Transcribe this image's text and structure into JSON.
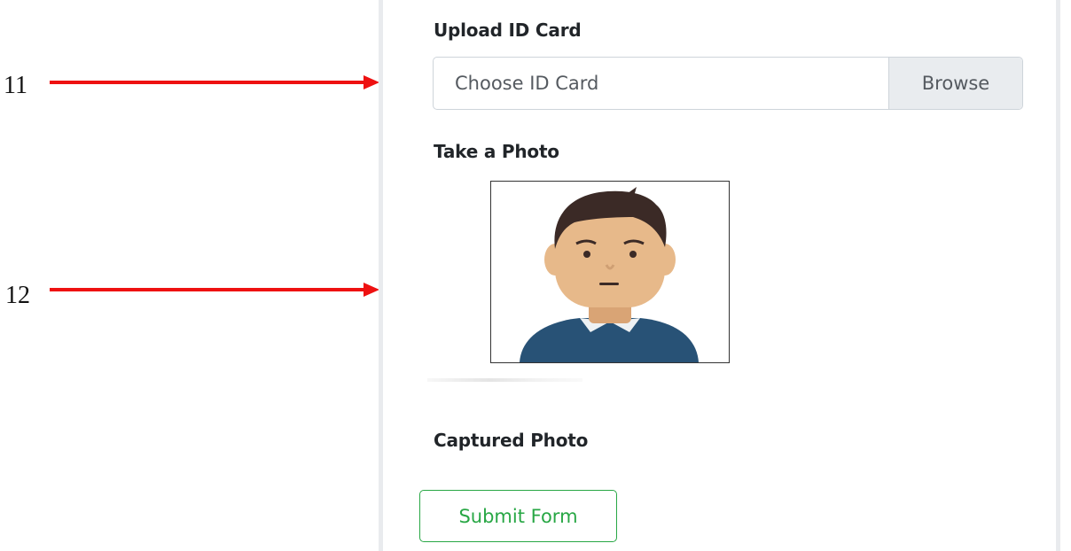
{
  "callouts": [
    {
      "number": "11"
    },
    {
      "number": "12"
    }
  ],
  "form": {
    "id_card": {
      "label": "Upload ID Card",
      "placeholder": "Choose ID Card",
      "browse_label": "Browse"
    },
    "photo": {
      "label": "Take a Photo",
      "image_subject": "person-avatar-icon"
    },
    "captured": {
      "label": "Captured Photo"
    },
    "submit_label": "Submit Form"
  },
  "colors": {
    "callout_arrow": "#ee1111",
    "submit_accent": "#28a745",
    "input_border": "#ced4da",
    "browse_bg": "#e9ecef",
    "avatar_skin": "#e7b98a",
    "avatar_hair": "#3b2a26",
    "avatar_shirt": "#285276"
  }
}
